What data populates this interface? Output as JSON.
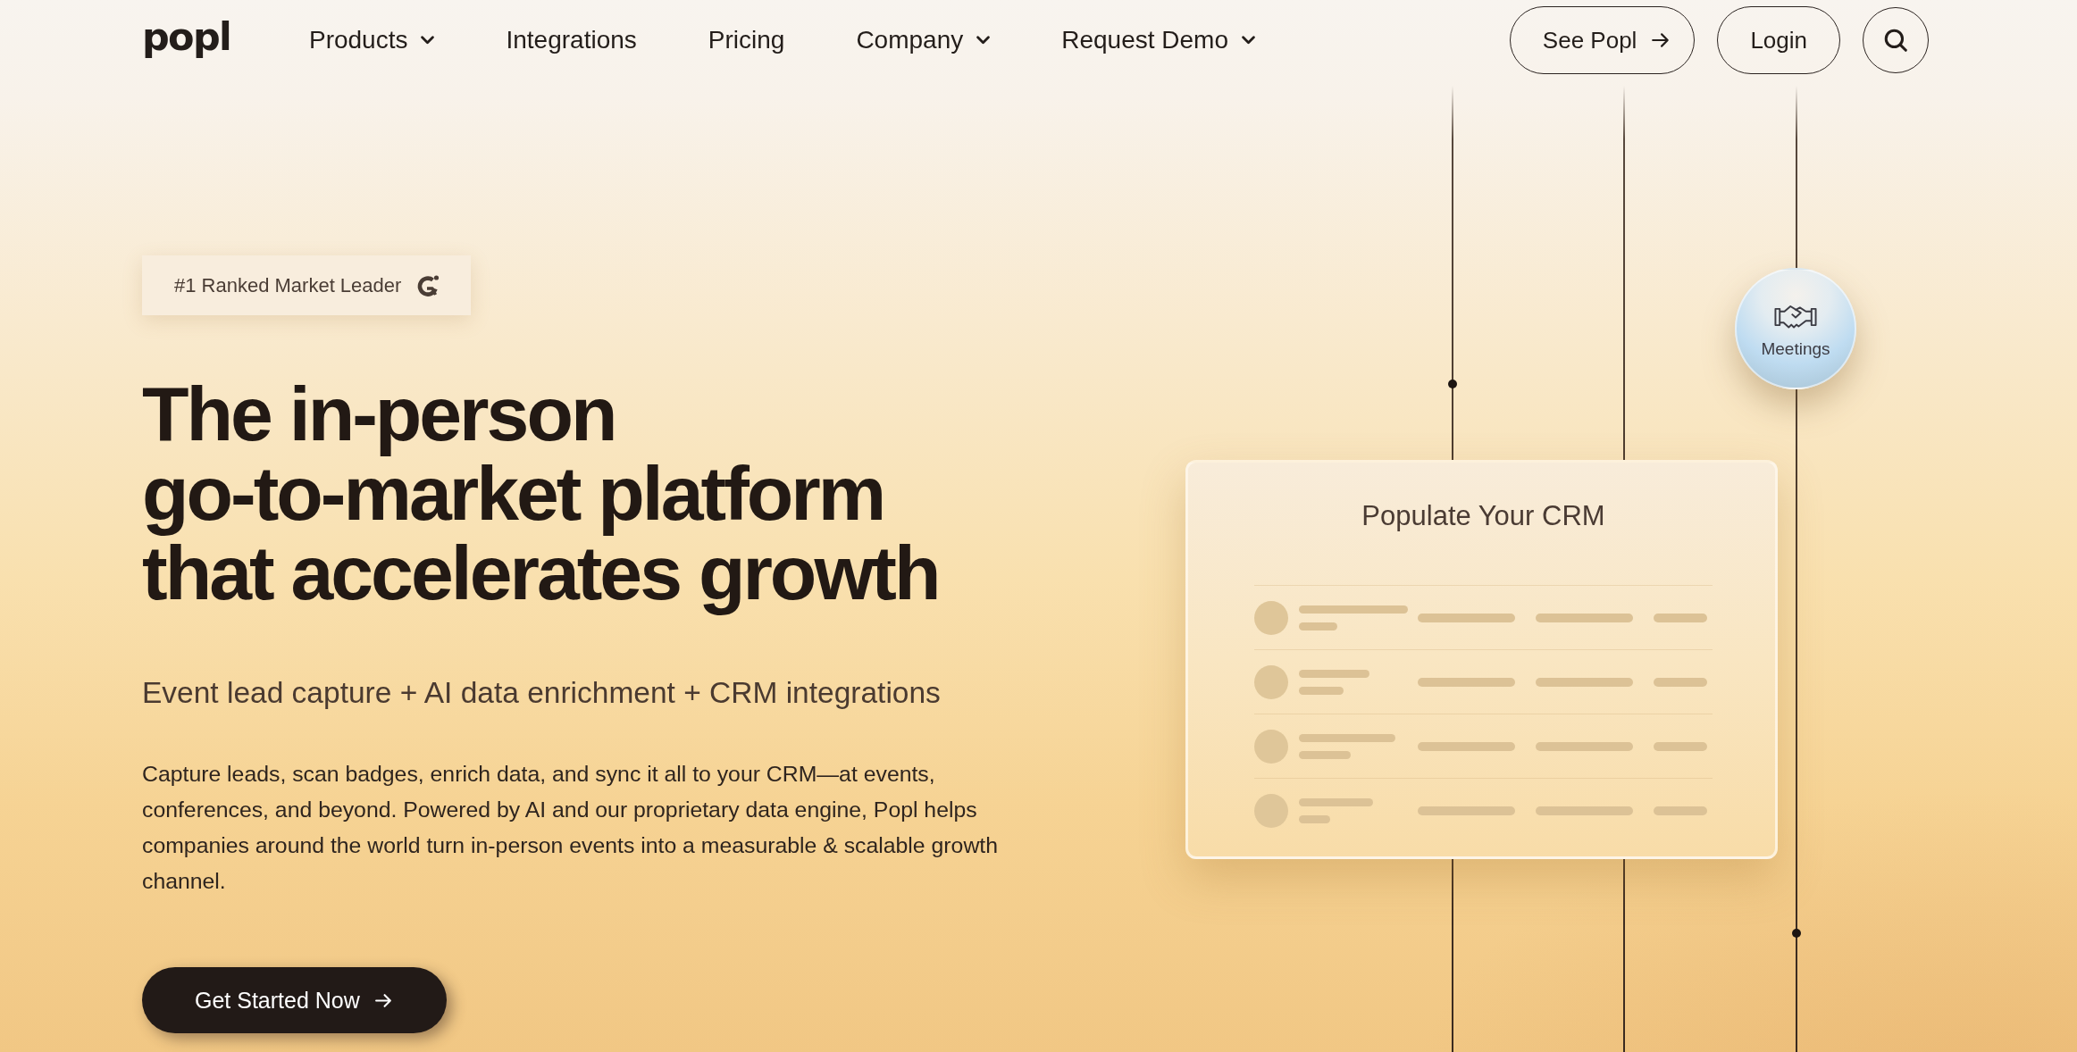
{
  "nav": {
    "logo": "popl",
    "links": [
      {
        "label": "Products",
        "has_menu": true
      },
      {
        "label": "Integrations",
        "has_menu": false
      },
      {
        "label": "Pricing",
        "has_menu": false
      },
      {
        "label": "Company",
        "has_menu": true
      },
      {
        "label": "Request Demo",
        "has_menu": true
      }
    ],
    "actions": [
      {
        "kind": "outline_arrow",
        "label": "See Popl"
      },
      {
        "kind": "outline",
        "label": "Login"
      },
      {
        "kind": "search"
      }
    ]
  },
  "hero": {
    "badge": "#1 Ranked Market Leader",
    "headline": "The in-person\ngo-to-market platform\nthat accelerates growth",
    "subtitle": "Event lead capture + AI data enrichment + CRM integrations",
    "body": "Capture leads, scan badges, enrich data, and sync it all to your CRM—at events, conferences, and beyond. Powered by AI and our proprietary data engine, Popl helps companies around the world turn in-person events into a measurable & scalable growth channel.",
    "cta": "Get Started Now"
  },
  "graphic": {
    "bubble_label": "Meetings",
    "card_title": "Populate Your CRM"
  }
}
